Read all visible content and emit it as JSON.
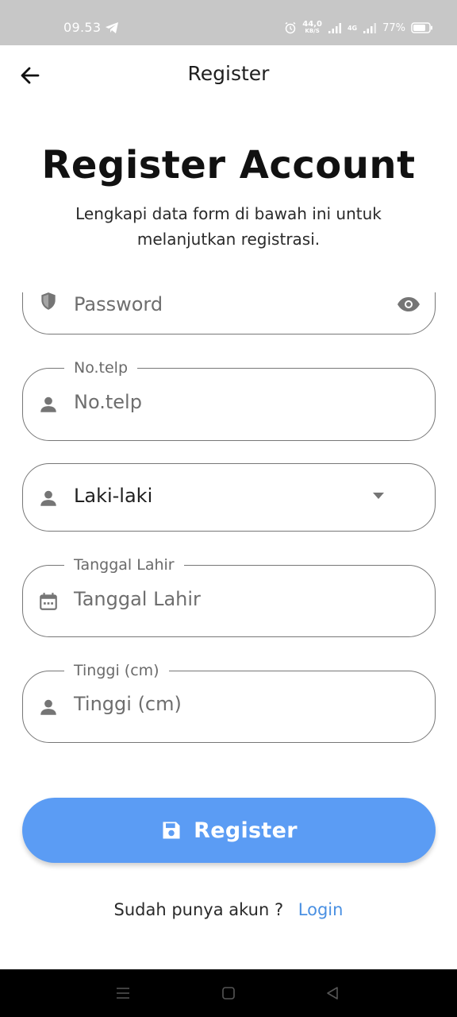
{
  "status_bar": {
    "time": "09.53",
    "net_speed_value": "44,0",
    "net_speed_unit": "KB/S",
    "network_label": "4G",
    "battery": "77%"
  },
  "app_bar": {
    "title": "Register"
  },
  "header": {
    "title": "Register Account",
    "subtitle": "Lengkapi data form di bawah ini untuk melanjutkan registrasi."
  },
  "form": {
    "password": {
      "placeholder": "Password"
    },
    "phone": {
      "label": "No.telp",
      "placeholder": "No.telp"
    },
    "gender": {
      "value": "Laki-laki"
    },
    "birth_date": {
      "label": "Tanggal Lahir",
      "placeholder": "Tanggal Lahir"
    },
    "height": {
      "label": "Tinggi (cm)",
      "placeholder": "Tinggi (cm)"
    }
  },
  "register_button": {
    "label": "Register"
  },
  "login_row": {
    "prompt": "Sudah punya akun ?",
    "link": "Login"
  },
  "colors": {
    "primary": "#5b9cf4",
    "link": "#4a90e2",
    "border": "#777777",
    "status_bar": "#c7c7c7"
  }
}
